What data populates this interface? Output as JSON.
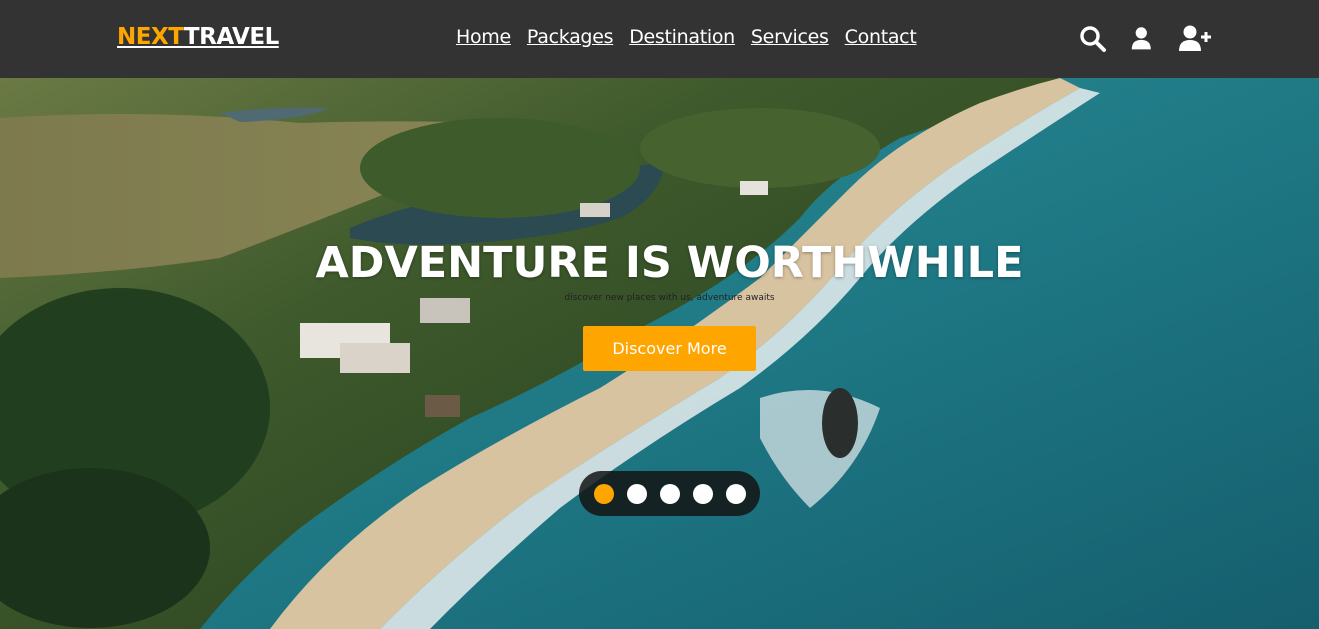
{
  "brand": {
    "part1": "NEXT",
    "part2": "TRAVEL",
    "accent_color": "#ffa500"
  },
  "nav": {
    "links": [
      "Home",
      "Packages",
      "Destination",
      "Services",
      "Contact"
    ],
    "icons": [
      "search-icon",
      "user-icon",
      "user-plus-icon"
    ]
  },
  "hero": {
    "title": "ADVENTURE IS WORTHWHILE",
    "subtitle": "discover new places with us, adventure awaits",
    "button_label": "Discover More",
    "slides": {
      "count": 5,
      "active_index": 0
    }
  },
  "colors": {
    "navbar": "#333333",
    "accent": "#ffa500",
    "text": "#ffffff"
  }
}
